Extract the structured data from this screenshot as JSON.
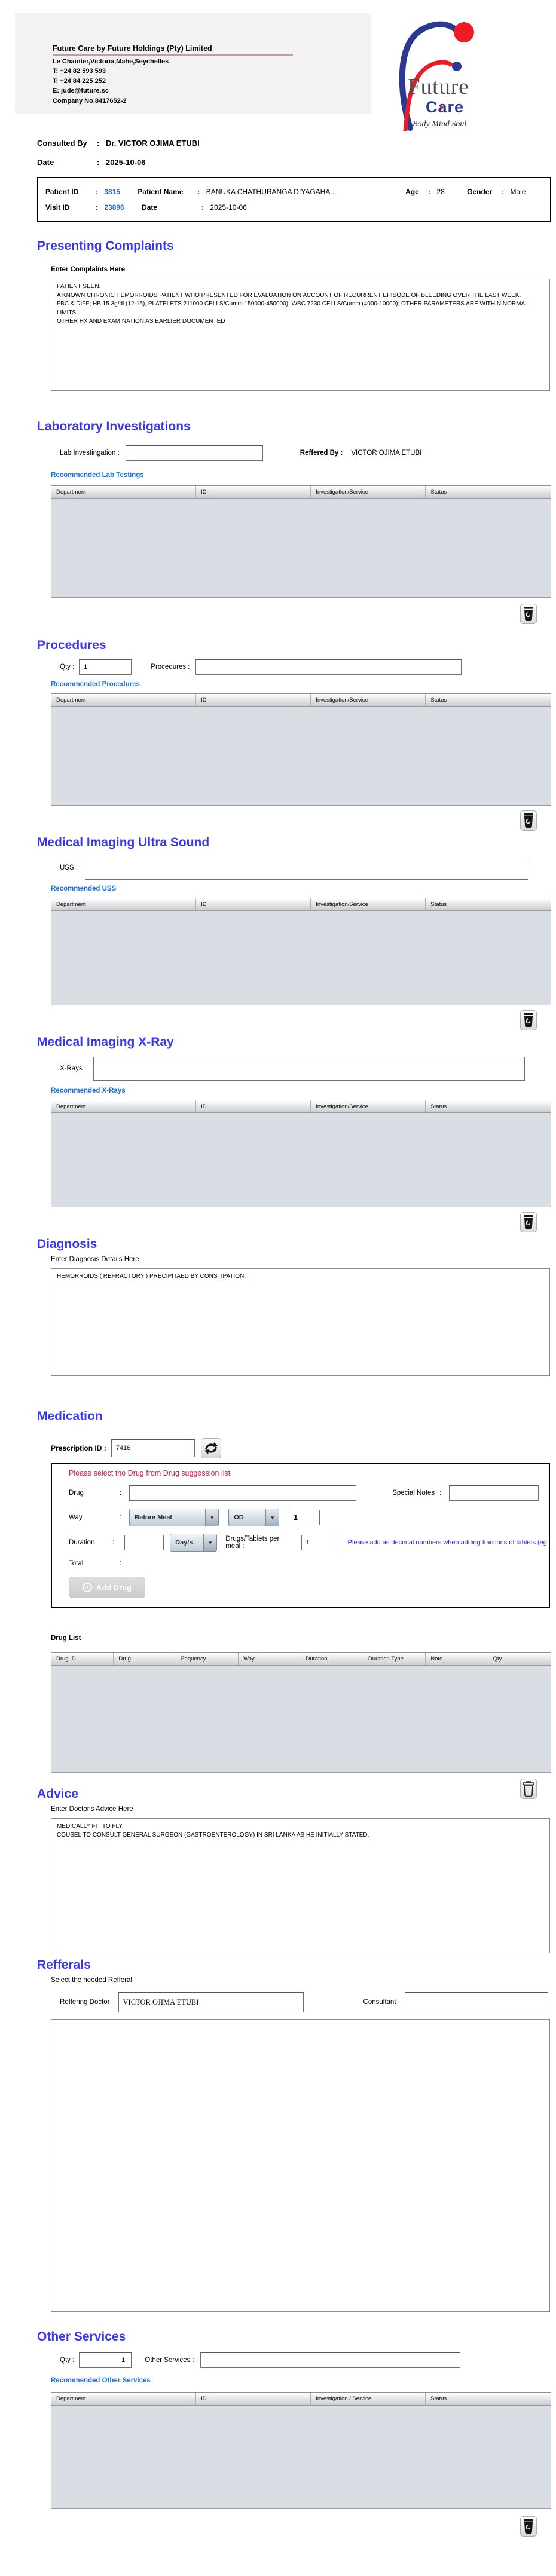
{
  "colors": {
    "header_blue": "#3a36ee",
    "link_blue": "#1772e0",
    "id_blue": "#2e6bd8",
    "alert_red": "#cb2653",
    "logo_blue": "#2b3990",
    "logo_red": "#ed1c24"
  },
  "header": {
    "company_title": "Future Care by Future Holdings (Pty) Limited",
    "address": "Le Chainter,Victoria,Mahe,Seychelles",
    "phone1": "T: +24  82 593 593",
    "phone2": "T: +24  84 225 252",
    "email": "E: jude@future.sc",
    "company_no": "Company No.8417652-2",
    "logo": {
      "future": "Future",
      "care": "Care",
      "tagline": "Body Mind Soul"
    }
  },
  "consultation": {
    "consulted_by_label": "Consulted By",
    "consulted_by_value": "Dr.  VICTOR OJIMA ETUBI",
    "date_label": "Date",
    "date_value": "2025-10-06"
  },
  "patient": {
    "patient_id_label": "Patient ID",
    "patient_id": "3815",
    "patient_name_label": "Patient Name",
    "patient_name": "BANUKA CHATHURANGA DIYAGAHA...",
    "age_label": "Age",
    "age": "28",
    "gender_label": "Gender",
    "gender": "Male",
    "visit_id_label": "Visit ID",
    "visit_id": "23896",
    "visit_date_label": "Date",
    "visit_date": "2025-10-06"
  },
  "presenting_complaints": {
    "title": "Presenting Complaints",
    "label": "Enter Complaints Here",
    "text": "PATIENT SEEN.\nA KNOWN CHRONIC HEMORROIDS PATIENT WHO PRESENTED FOR EVALUATION ON ACCOUNT OF RECURRENT EPISODE OF BLEEDING OVER THE LAST WEEK.\nFBC & DIFF; HB 15.3g/dl (12-15), PLATELETS 211000 CELLS/Cumm 150000-450000), WBC 7230 CELLS/Cumm (4000-10000); OTHER PARAMETERS ARE WITHIN NORMAL LIMITS.\nOTHER HX AND EXAMINATION AS EARLIER DOCUMENTED"
  },
  "laboratory": {
    "title": "Laboratory  Investigations",
    "input_label": "Lab Investingation",
    "referred_by_label": "Reffered By",
    "referred_by_value": "VICTOR OJIMA ETUBI",
    "recommended": "Recommended Lab Testings",
    "table_headers": [
      "Department",
      "ID",
      "Investigation/Service",
      "Status"
    ]
  },
  "procedures": {
    "title": "Procedures",
    "qty_label": "Qty",
    "qty_value": "1",
    "input_label": "Procedures",
    "recommended": "Recommended Procedures",
    "table_headers": [
      "Department",
      "ID",
      "Investigation/Service",
      "Status"
    ]
  },
  "ultrasound": {
    "title": "Medical Imaging Ultra Sound",
    "input_label": "USS",
    "recommended": "Recommended USS",
    "table_headers": [
      "Department",
      "ID",
      "Investigation/Service",
      "Status"
    ]
  },
  "xray": {
    "title": "Medical Imaging X-Ray",
    "input_label": "X-Rays",
    "recommended": "Recommended X-Rays",
    "table_headers": [
      "Department",
      "ID",
      "Investigation/Service",
      "Status"
    ]
  },
  "diagnosis": {
    "title": "Diagnosis",
    "label": "Enter Diagnosis Details Here",
    "text": "HEMORROIDS ( REFRACTORY ) PRECIPITAED BY CONSTIPATION."
  },
  "medication": {
    "title": "Medication",
    "prescription_label": "Prescription ID",
    "prescription_value": "7416",
    "suggestion_note": "Please select the Drug from Drug suggession list",
    "drug_label": "Drug",
    "special_notes_label": "Special Notes",
    "way_label": "Way",
    "way_option": "Before Meal",
    "frequency_option": "OD",
    "frequency_qty": "1",
    "duration_label": "Duration",
    "duration_unit": "Day/s",
    "per_meal_label": "Drugs/Tablets per meal",
    "per_meal_value": "1",
    "decimal_note": "Please add as decimal numbers when adding fractions of tablets (eg:",
    "total_label": "Total",
    "add_drug_label": "Add Drug"
  },
  "drug_list": {
    "label": "Drug List",
    "table_headers": [
      "Drug ID",
      "Drug",
      "Fequency",
      "Way",
      "Duration",
      "Duration Type",
      "Note",
      "Qty"
    ]
  },
  "advice": {
    "title": "Advice",
    "label": "Enter Doctor's Advice Here",
    "text": "MEDICALLY FIT TO FLY\nCOUSEL TO CONSULT GENERAL SURGEON (GASTROENTEROLOGY) IN SRI LANKA AS HE INITIALLY STATED."
  },
  "referrals": {
    "title": "Refferals",
    "label": "Select the needed Refferal",
    "referring_doctor_label": "Reffering Doctor",
    "referring_doctor_value": "VICTOR OJIMA ETUBI",
    "consultant_label": "Consultant",
    "consultant_value": ""
  },
  "other_services": {
    "title": "Other Services",
    "qty_label": "Qty",
    "qty_value": "1",
    "input_label": "Other Services",
    "recommended": "Recommended Other Services",
    "table_headers": [
      "Department",
      "ID",
      "Investigation / Service",
      "Status"
    ]
  }
}
